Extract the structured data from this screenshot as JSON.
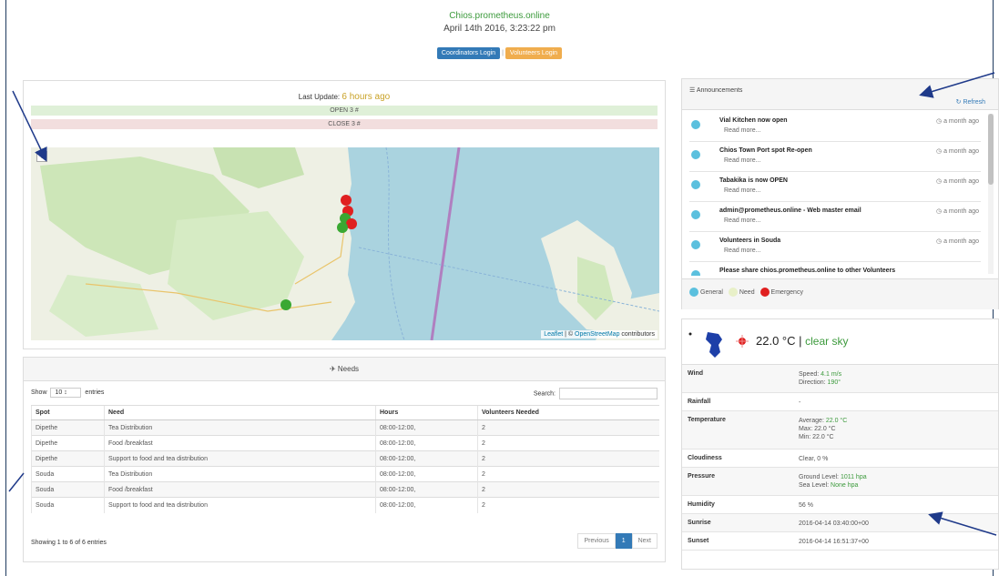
{
  "header": {
    "site": "Chios.prometheus.online",
    "datetime": "April 14th 2016, 3:23:22 pm",
    "coordinators_login": "Coordinators Login",
    "separator": "|",
    "volunteers_login": "Volunteers Login"
  },
  "status": {
    "last_update_label": "Last Update:",
    "last_update_value": "6 hours ago",
    "open_text": "OPEN 3 #",
    "close_text": "CLOSE 3 #"
  },
  "map": {
    "zoom_in": "+",
    "attr_leaflet": "Leaflet",
    "attr_sep": " | © ",
    "attr_osm": "OpenStreetMap",
    "attr_contrib": " contributors"
  },
  "needs": {
    "title": "Needs",
    "show_label": "Show",
    "entries_select": "10",
    "entries_label": "entries",
    "search_label": "Search:",
    "columns": [
      "Spot",
      "Need",
      "Hours",
      "Volunteers Needed"
    ],
    "rows": [
      [
        "Dipethe",
        "Tea Distribution",
        "08:00-12:00,",
        "2"
      ],
      [
        "Dipethe",
        "Food /breakfast",
        "08:00-12:00,",
        "2"
      ],
      [
        "Dipethe",
        "Support to food and tea distribution",
        "08:00-12:00,",
        "2"
      ],
      [
        "Souda",
        "Tea Distribution",
        "08:00-12:00,",
        "2"
      ],
      [
        "Souda",
        "Food /breakfast",
        "08:00-12:00,",
        "2"
      ],
      [
        "Souda",
        "Support to food and tea distribution",
        "08:00-12:00,",
        "2"
      ]
    ],
    "showing": "Showing 1 to 6 of 6 entries",
    "prev": "Previous",
    "page": "1",
    "next": "Next"
  },
  "announcements": {
    "title": "Announcements",
    "refresh": "Refresh",
    "read_more": "Read more...",
    "items": [
      {
        "text": "Vial Kitchen now open",
        "time": "a month ago"
      },
      {
        "text": "Chios Town Port spot Re-open",
        "time": "a month ago"
      },
      {
        "text": "Tabakika is now OPEN",
        "time": "a month ago"
      },
      {
        "text": "admin@prometheus.online - Web master email",
        "time": "a month ago"
      },
      {
        "text": "Volunteers in Souda",
        "time": "a month ago"
      },
      {
        "text": "Please share chios.prometheus.online to other Volunteers",
        "time": ""
      }
    ],
    "legend": {
      "general": "General",
      "need": "Need",
      "emergency": "Emergency"
    },
    "colors": {
      "general": "#5bc0de",
      "need": "#e8f0c8",
      "emergency": "#e02020"
    }
  },
  "weather": {
    "temp": "22.0 °C",
    "bar": " | ",
    "sky": "clear sky",
    "rows": {
      "wind_label": "Wind",
      "wind_speed_label": "Speed:",
      "wind_speed": "4.1 m/s",
      "wind_dir_label": "Direction:",
      "wind_dir": "190°",
      "rain_label": "Rainfall",
      "rain": "-",
      "temp_label": "Temperature",
      "avg_label": "Average:",
      "avg": "22.0 °C",
      "max": "Max: 22.0 °C",
      "min": "Min: 22.0 °C",
      "cloud_label": "Cloudiness",
      "cloud": "Clear, 0 %",
      "pressure_label": "Pressure",
      "ground_label": "Ground Level:",
      "ground": "1011 hpa",
      "sea_label": "Sea Level:",
      "sea": "None hpa",
      "humidity_label": "Humidity",
      "humidity": "56 %",
      "sunrise_label": "Sunrise",
      "sunrise": "2016-04-14 03:40:00+00",
      "sunset_label": "Sunset",
      "sunset": "2016-04-14 16:51:37+00"
    }
  }
}
